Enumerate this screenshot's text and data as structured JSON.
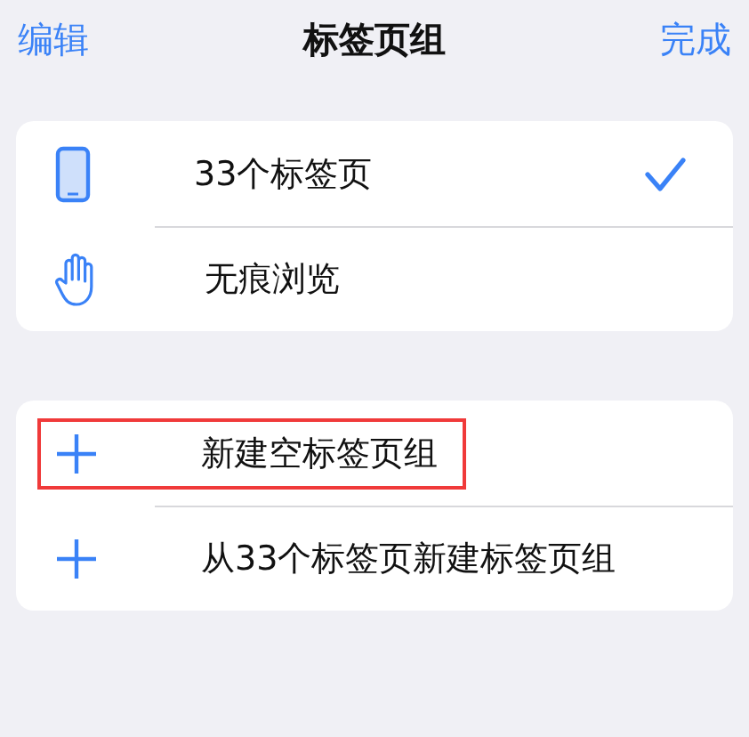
{
  "nav": {
    "left": "编辑",
    "title": "标签页组",
    "right": "完成"
  },
  "groups": [
    {
      "items": [
        {
          "kind": "phone",
          "label": "33个标签页",
          "selected": true,
          "highlighted": false
        },
        {
          "kind": "hand",
          "label": "无痕浏览",
          "selected": false,
          "highlighted": false
        }
      ]
    },
    {
      "items": [
        {
          "kind": "plus",
          "label": "新建空标签页组",
          "highlighted": true
        },
        {
          "kind": "plus",
          "label": "从33个标签页新建标签页组",
          "highlighted": false
        }
      ]
    }
  ]
}
